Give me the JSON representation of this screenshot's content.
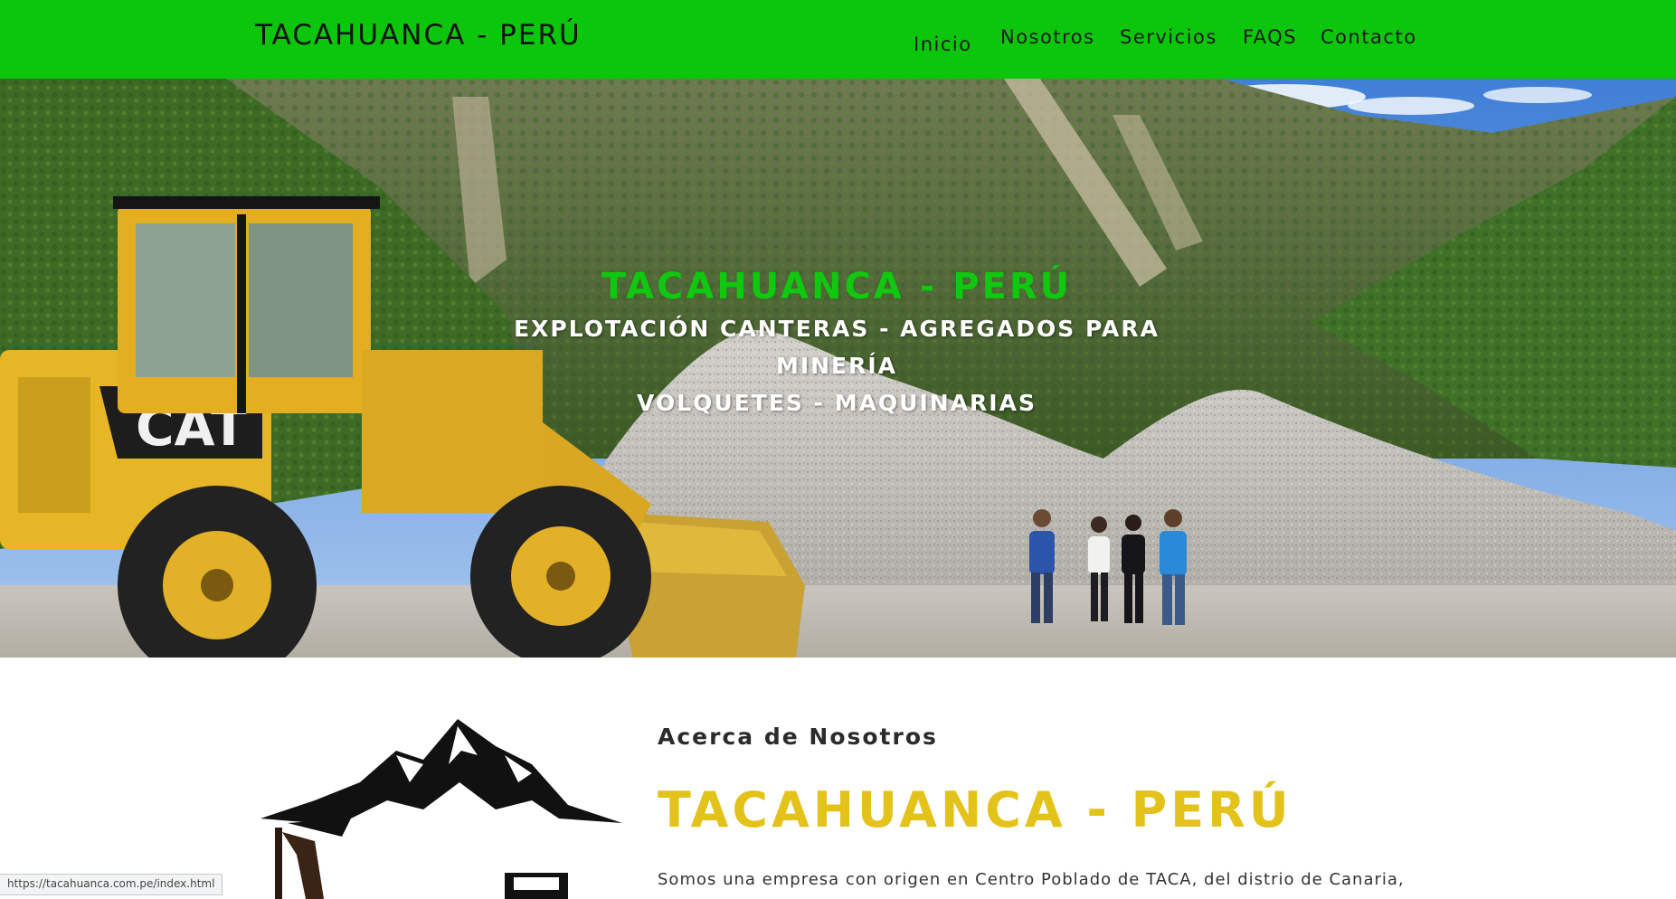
{
  "navbar": {
    "brand": "TACAHUANCA - PERÚ",
    "links": [
      {
        "label": "Inicio"
      },
      {
        "label": "Nosotros"
      },
      {
        "label": "Servicios"
      },
      {
        "label": "FAQS"
      },
      {
        "label": "Contacto"
      }
    ],
    "background_color": "#0bc60a"
  },
  "hero": {
    "title": "TACAHUANCA - PERÚ",
    "subtitle_line1": "EXPLOTACIÓN CANTERAS - AGREGADOS PARA",
    "subtitle_line2": "MINERÍA",
    "subtitle_line3": "VOLQUETES - MAQUINARIAS",
    "title_color": "#10c810",
    "image_logo_text": "CAT"
  },
  "about": {
    "eyebrow": "Acerca de Nosotros",
    "title": "TACAHUANCA - PERÚ",
    "paragraph": "Somos una empresa con origen en Centro Poblado de TACA, del distrio de Canaria,",
    "title_color": "#e3c21a"
  },
  "status_bar": {
    "url": "https://tacahuanca.com.pe/index.html"
  }
}
